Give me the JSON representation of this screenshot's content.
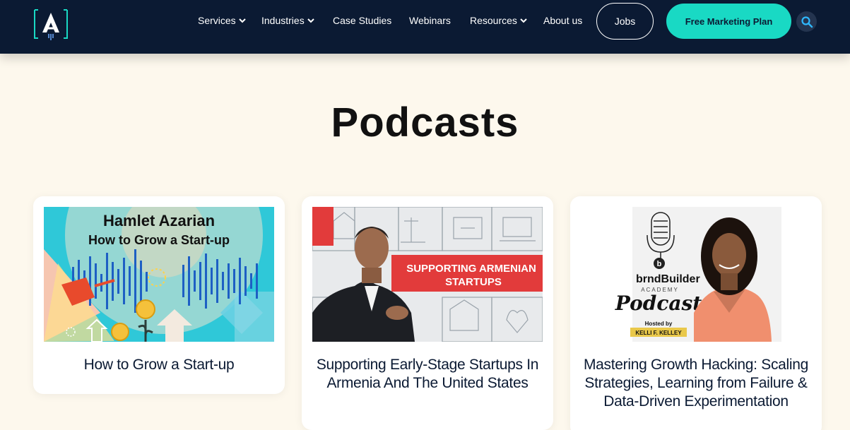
{
  "header": {
    "logo_icon": "agency-logo-icon",
    "nav": [
      {
        "label": "Services",
        "dropdown": true
      },
      {
        "label": "Industries",
        "dropdown": true
      },
      {
        "label": "Case Studies",
        "dropdown": false
      },
      {
        "label": "Webinars",
        "dropdown": false
      },
      {
        "label": "Resources",
        "dropdown": true
      },
      {
        "label": "About us",
        "dropdown": false
      }
    ],
    "jobs_label": "Jobs",
    "cta_label": "Free Marketing Plan",
    "search_icon": "search-icon"
  },
  "page_title": "Podcasts",
  "cards": [
    {
      "title": "How to Grow a Start-up",
      "thumb": {
        "line1": "Hamlet Azarian",
        "line2": "How to Grow a Start-up"
      }
    },
    {
      "title": "Supporting Early-Stage Startups In Armenia And The United States",
      "thumb": {
        "line1": "SUPPORTING ARMENIAN",
        "line2": "STARTUPS"
      }
    },
    {
      "title": "Mastering Growth Hacking: Scaling Strategies, Learning from Failure & Data-Driven Experimentation",
      "thumb": {
        "brand": "brndBuilder",
        "sub": "ACADEMY",
        "word": "Podcast",
        "hosted": "Hosted by",
        "host": "KELLI F. KELLEY"
      }
    }
  ],
  "colors": {
    "header_bg": "#0b1a33",
    "accent": "#19d9c4",
    "page_bg": "#fdf8ed"
  }
}
